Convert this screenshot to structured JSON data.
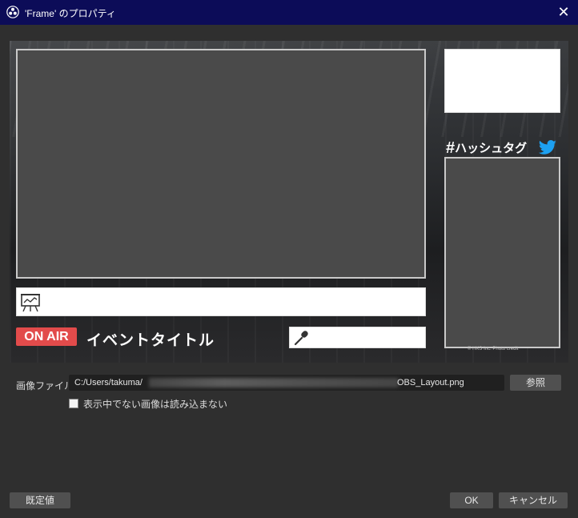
{
  "window": {
    "title": "'Frame' のプロパティ",
    "close_symbol": "✕"
  },
  "preview": {
    "on_air": "ON AIR",
    "event_title": "イベントタイトル",
    "hashtag_symbol": "#",
    "hashtag_text": "ハッシュタグ",
    "credit": "© HKS Inc. Photo credit"
  },
  "form": {
    "image_file_label": "画像ファイル",
    "path_start": "C:/Users/takuma/",
    "path_end": "OBS_Layout.png",
    "browse_label": "参照",
    "unload_checkbox_label": "表示中でない画像は読み込まない"
  },
  "footer": {
    "defaults_label": "既定値",
    "ok_label": "OK",
    "cancel_label": "キャンセル"
  },
  "colors": {
    "titlebar": "#0c0c58",
    "on_air": "#e24b4b",
    "twitter": "#1da1f2"
  }
}
